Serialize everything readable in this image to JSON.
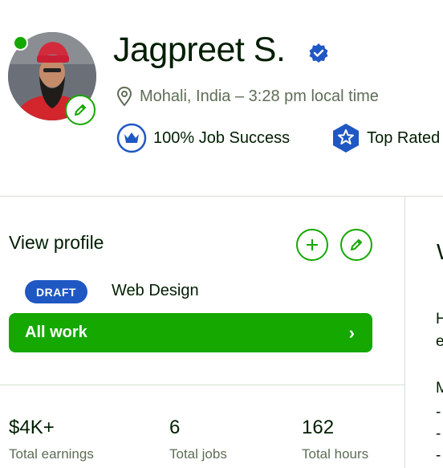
{
  "profile": {
    "name": "Jagpreet S.",
    "location": "Mohali, India – 3:28 pm local time",
    "badges": [
      {
        "label": "100% Job Success",
        "icon": "crown-icon"
      },
      {
        "label": "Top Rated",
        "icon": "star-badge-icon"
      }
    ],
    "online": true
  },
  "panel": {
    "view_profile": "View profile",
    "draft_badge": "DRAFT",
    "specialized_profile": "Web Design",
    "all_work": "All work",
    "all_work_arrow": "›"
  },
  "stats": [
    {
      "value": "$4K+",
      "label": "Total earnings"
    },
    {
      "value": "6",
      "label": "Total jobs"
    },
    {
      "value": "162",
      "label": "Total hours"
    }
  ],
  "right_panel_fragments": [
    "W",
    "H",
    "e",
    "M",
    "-",
    "-",
    "-"
  ],
  "colors": {
    "accent_green": "#14a800",
    "badge_blue": "#1f57c3",
    "text_dark": "#001e00",
    "text_muted": "#5e6d55",
    "divider": "#d5e0d5"
  }
}
